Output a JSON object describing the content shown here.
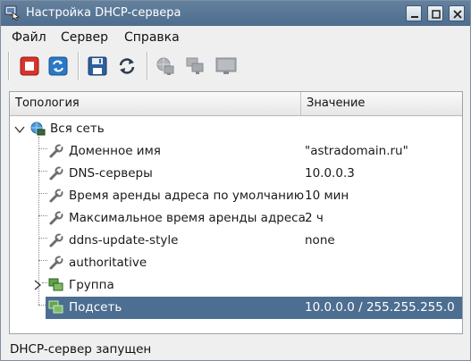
{
  "window": {
    "title": "Настройка DHCP-сервера"
  },
  "menu": [
    {
      "label": "Файл"
    },
    {
      "label": "Сервер"
    },
    {
      "label": "Справка"
    }
  ],
  "toolbar": [
    {
      "icon": "stop-icon",
      "enabled": true
    },
    {
      "icon": "restart-icon",
      "enabled": true
    },
    {
      "icon": "save-icon",
      "enabled": true
    },
    {
      "icon": "refresh-icon",
      "enabled": true
    },
    {
      "icon": "network-globe-icon",
      "enabled": false
    },
    {
      "icon": "network-group-icon",
      "enabled": false
    },
    {
      "icon": "monitor-icon",
      "enabled": false
    }
  ],
  "tree": {
    "columns": [
      "Топология",
      "Значение"
    ],
    "root": {
      "label": "Вся сеть",
      "icon": "network-globe-icon",
      "expanded": true
    },
    "rows": [
      {
        "label": "Доменное имя",
        "value": "\"astradomain.ru\"",
        "icon": "wrench-icon"
      },
      {
        "label": "DNS-серверы",
        "value": "10.0.0.3",
        "icon": "wrench-icon"
      },
      {
        "label": "Время аренды адреса по умолчанию",
        "value": "10 мин",
        "icon": "wrench-icon"
      },
      {
        "label": "Максимальное время аренды адреса",
        "value": "2 ч",
        "icon": "wrench-icon"
      },
      {
        "label": "ddns-update-style",
        "value": "none",
        "icon": "wrench-icon"
      },
      {
        "label": "authoritative",
        "value": "",
        "icon": "wrench-icon"
      },
      {
        "label": "Группа",
        "value": "",
        "icon": "group-icon",
        "expandable": true
      },
      {
        "label": "Подсеть",
        "value": "10.0.0.0 / 255.255.255.0",
        "icon": "subnet-icon",
        "selected": true
      }
    ]
  },
  "status": {
    "text": "DHCP-сервер запущен"
  },
  "colors": {
    "titlebar": "#4f6d8c",
    "selection": "#4c6e91",
    "stop_red": "#d9342b",
    "restart_blue": "#2a78c8"
  }
}
